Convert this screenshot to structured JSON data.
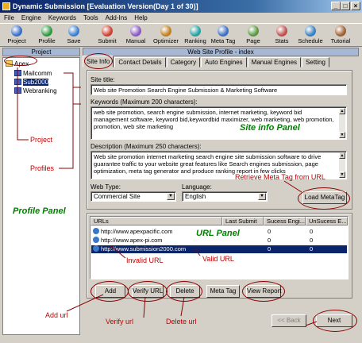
{
  "window": {
    "title": "Dynamic Submission [Evaluation Version(Day 1 of 30)]",
    "btn_min": "_",
    "btn_max": "□",
    "btn_close": "×"
  },
  "menu": [
    "File",
    "Engine",
    "Keywords",
    "Tools",
    "Add-Ins",
    "Help"
  ],
  "toolbar": [
    {
      "label": "Project",
      "color": "#3a6ec8",
      "icon": "project-icon"
    },
    {
      "label": "Profile",
      "color": "#2e9a3e",
      "icon": "profile-icon"
    },
    {
      "label": "Save",
      "color": "#3c7fd0",
      "icon": "save-icon"
    },
    {
      "label": "Submit",
      "color": "#d04030",
      "icon": "submit-icon"
    },
    {
      "label": "Manual",
      "color": "#8a5ac0",
      "icon": "manual-icon"
    },
    {
      "label": "Optimizer",
      "color": "#c08020",
      "icon": "optimizer-icon"
    },
    {
      "label": "Ranking",
      "color": "#2aa0a0",
      "icon": "ranking-icon"
    },
    {
      "label": "Meta Tag",
      "color": "#4070c0",
      "icon": "meta-tag-icon"
    },
    {
      "label": "Page",
      "color": "#5a9a40",
      "icon": "page-icon"
    },
    {
      "label": "Stats",
      "color": "#c05050",
      "icon": "stats-icon"
    },
    {
      "label": "Schedule",
      "color": "#3a80c0",
      "icon": "schedule-icon"
    },
    {
      "label": "Tutorial",
      "color": "#a06030",
      "icon": "tutorial-icon"
    }
  ],
  "project_panel": {
    "header": "Project",
    "items": [
      "Apex",
      "Mailcomm",
      "Sub2000",
      "Webranking"
    ],
    "selected_index": 2
  },
  "profile_header": "Web Site Profile - index",
  "tabs": [
    "Site Info",
    "Contact Details",
    "Category",
    "Auto Engines",
    "Manual Engines",
    "Setting"
  ],
  "site_info": {
    "site_title_label": "Site title:",
    "site_title": "Web site Promotion Search Engine Submission & Marketing Software",
    "keywords_label": "Keywords (Maximum 200 characters):",
    "keywords": "web site promotion, search engine submission, internet marketing, keyword bid management software, keyword bid,keywordbid maximizer, web marketing, web promotion, promotion, web site marketing",
    "description_label": "Description (Maximum 250 characters):",
    "description": "Web site promotion internet marketing search engine site submission software to drive guarantee traffic to your website great features like Search engines submission, page optimization, meta tag generator and produce ranking report in few clicks",
    "web_type_label": "Web Type:",
    "web_type": "Commercial Site",
    "language_label": "Language:",
    "language": "English",
    "load_meta_label": "Load MetaTag"
  },
  "urls": {
    "headers": [
      "URLs",
      "Last Submit",
      "Sucess Engi...",
      "UnSucess E..."
    ],
    "rows": [
      {
        "url": "http://www.apexpacific.com",
        "last": "",
        "success": "0",
        "unsuccess": "0"
      },
      {
        "url": "http://www.apex-pi.com",
        "last": "",
        "success": "0",
        "unsuccess": "0"
      },
      {
        "url": "http://www.submission2000.com",
        "last": "",
        "success": "0",
        "unsuccess": "0"
      }
    ],
    "selected_row": 2
  },
  "buttons": {
    "add": "Add",
    "verify": "Verify URL",
    "delete": "Delete",
    "meta_tag": "Meta Tag",
    "view_report": "View Report",
    "back": "<< Back",
    "next": "Next"
  },
  "annotations": {
    "site_info_panel": "Site info Panel",
    "url_panel": "URL Panel",
    "profile_panel": "Profile Panel",
    "project": "Project",
    "profiles": "Profiles",
    "retrieve_meta": "Retrieve Meta Tag from URL",
    "invalid_url": "Invalid URL",
    "valid_url": "Valid URL",
    "add_url": "Add url",
    "verify_url": "Verify url",
    "delete_url": "Delete url"
  },
  "colors": {
    "title_bar": "#0a246a",
    "annotation_red": "#c00000",
    "annotation_green": "#008000",
    "selection": "#0a246a"
  }
}
